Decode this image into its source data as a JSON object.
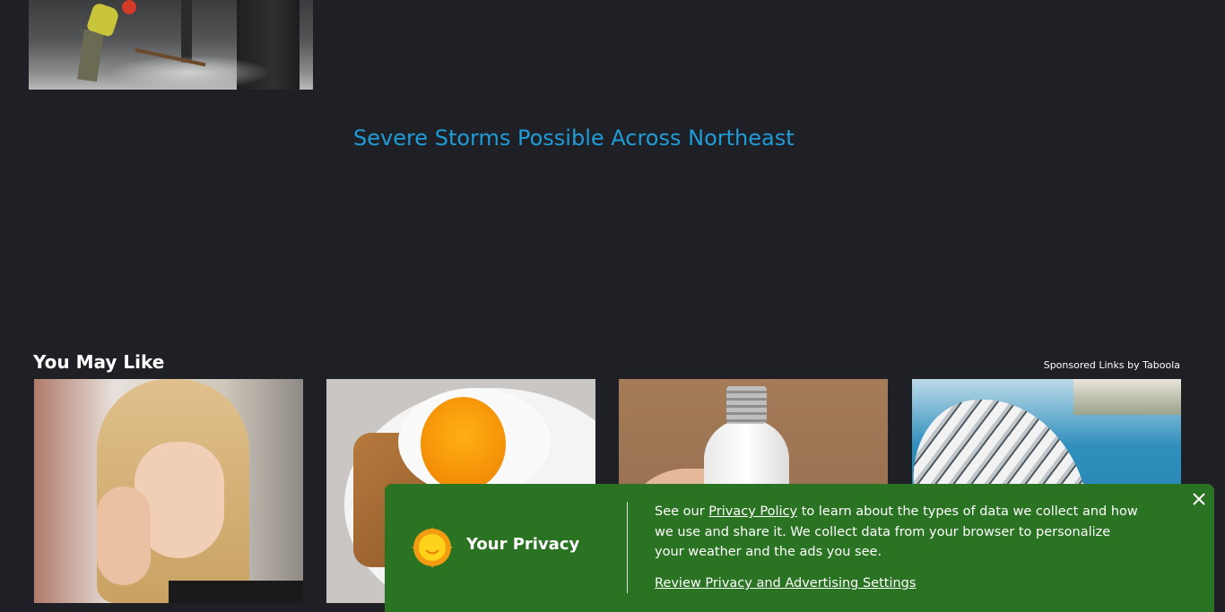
{
  "article": {
    "headline_link": "Severe Storms Possible Across Northeast"
  },
  "recommendations": {
    "title": "You May Like",
    "sponsored_label": "Sponsored Links by Taboola",
    "cards": [
      {
        "image_icon": "woman-rubbing-eye-photo"
      },
      {
        "image_icon": "poached-egg-on-toast-photo"
      },
      {
        "image_icon": "light-bulb-camera-photo"
      },
      {
        "image_icon": "cruise-ship-aerial-photo"
      }
    ]
  },
  "privacy_banner": {
    "title": "Your Privacy",
    "text_before": "See our ",
    "policy_link": "Privacy Policy",
    "text_after": " to learn about the types of data we collect and how we use and share it. We collect data from your browser to personalize your weather and the ads you see.",
    "review_link": "Review Privacy and Advertising Settings",
    "close_icon": "close-icon",
    "sun_icon": "sun-icon"
  },
  "colors": {
    "page_bg": "#1f2025",
    "link_blue": "#1e9cd7",
    "banner_green": "#2a7322"
  }
}
